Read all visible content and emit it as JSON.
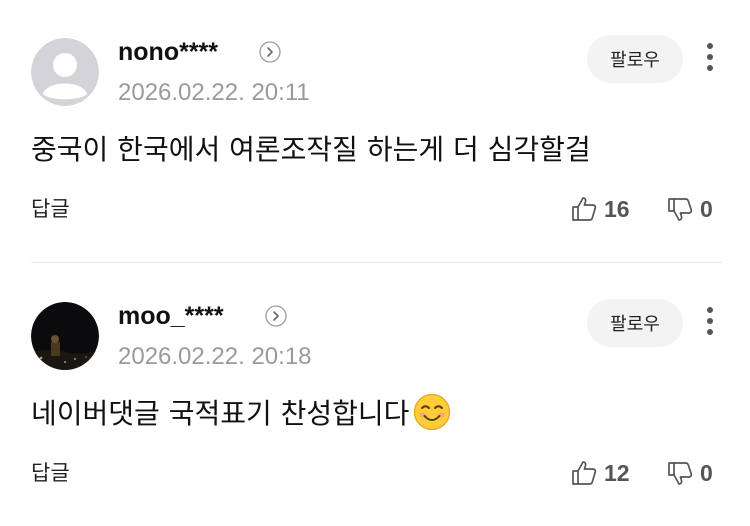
{
  "comments": [
    {
      "username": "nono****",
      "timestamp": "2026.02.22. 20:11",
      "follow_label": "팔로우",
      "text": "중국이 한국에서 여론조작질 하는게 더 심각할걸",
      "reply_label": "답글",
      "likes": "16",
      "dislikes": "0",
      "avatar_icon": "default-person-icon"
    },
    {
      "username": "moo_****",
      "timestamp": "2026.02.22. 20:18",
      "follow_label": "팔로우",
      "text": "네이버댓글 국적표기 찬성합니다",
      "emoji": "smiling-face-emoji",
      "reply_label": "답글",
      "likes": "12",
      "dislikes": "0",
      "avatar_icon": "night-photo-avatar"
    }
  ],
  "colors": {
    "text": "#111111",
    "muted": "#9a9a9a",
    "count": "#555555",
    "follow_bg": "#f3f3f3",
    "divider": "#e8e8e8",
    "default_avatar": "#d4d4d8"
  }
}
